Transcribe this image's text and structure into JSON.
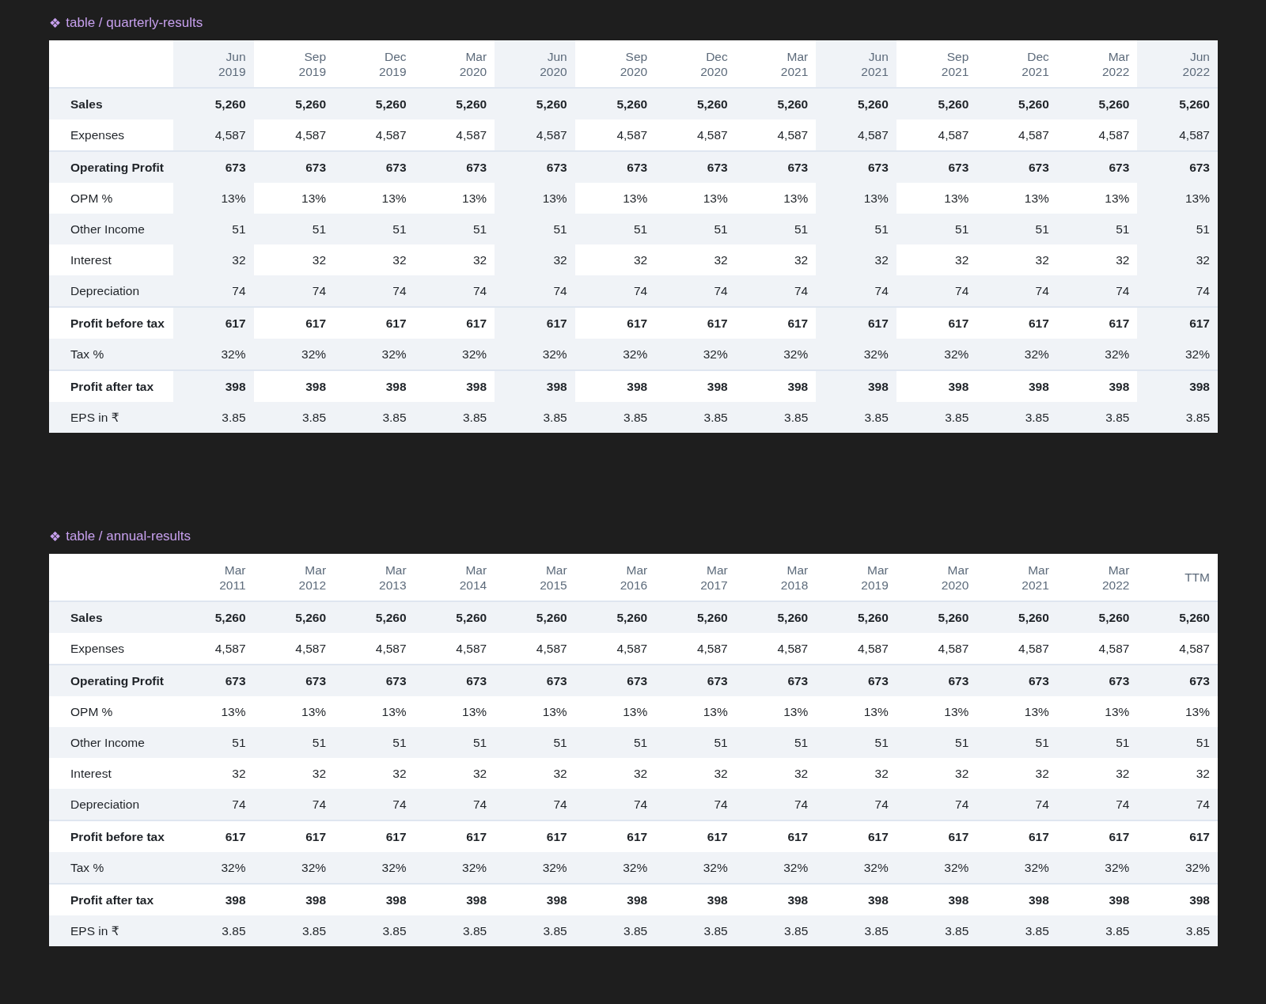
{
  "tables": [
    {
      "icon": "❖",
      "title": "table / quarterly-results",
      "columns": [
        {
          "lines": [
            "Jun",
            "2019"
          ],
          "highlighted": true
        },
        {
          "lines": [
            "Sep",
            "2019"
          ],
          "highlighted": false
        },
        {
          "lines": [
            "Dec",
            "2019"
          ],
          "highlighted": false
        },
        {
          "lines": [
            "Mar",
            "2020"
          ],
          "highlighted": false
        },
        {
          "lines": [
            "Jun",
            "2020"
          ],
          "highlighted": true
        },
        {
          "lines": [
            "Sep",
            "2020"
          ],
          "highlighted": false
        },
        {
          "lines": [
            "Dec",
            "2020"
          ],
          "highlighted": false
        },
        {
          "lines": [
            "Mar",
            "2021"
          ],
          "highlighted": false
        },
        {
          "lines": [
            "Jun",
            "2021"
          ],
          "highlighted": true
        },
        {
          "lines": [
            "Sep",
            "2021"
          ],
          "highlighted": false
        },
        {
          "lines": [
            "Dec",
            "2021"
          ],
          "highlighted": false
        },
        {
          "lines": [
            "Mar",
            "2022"
          ],
          "highlighted": false
        },
        {
          "lines": [
            "Jun",
            "2022"
          ],
          "highlighted": true
        }
      ],
      "rows": [
        {
          "label": "Sales",
          "bold": true,
          "divider": false,
          "values": [
            "5,260",
            "5,260",
            "5,260",
            "5,260",
            "5,260",
            "5,260",
            "5,260",
            "5,260",
            "5,260",
            "5,260",
            "5,260",
            "5,260",
            "5,260"
          ]
        },
        {
          "label": "Expenses",
          "bold": false,
          "divider": false,
          "values": [
            "4,587",
            "4,587",
            "4,587",
            "4,587",
            "4,587",
            "4,587",
            "4,587",
            "4,587",
            "4,587",
            "4,587",
            "4,587",
            "4,587",
            "4,587"
          ]
        },
        {
          "label": "Operating Profit",
          "bold": true,
          "divider": true,
          "values": [
            "673",
            "673",
            "673",
            "673",
            "673",
            "673",
            "673",
            "673",
            "673",
            "673",
            "673",
            "673",
            "673"
          ]
        },
        {
          "label": "OPM %",
          "bold": false,
          "divider": false,
          "values": [
            "13%",
            "13%",
            "13%",
            "13%",
            "13%",
            "13%",
            "13%",
            "13%",
            "13%",
            "13%",
            "13%",
            "13%",
            "13%"
          ]
        },
        {
          "label": "Other Income",
          "bold": false,
          "divider": false,
          "values": [
            "51",
            "51",
            "51",
            "51",
            "51",
            "51",
            "51",
            "51",
            "51",
            "51",
            "51",
            "51",
            "51"
          ]
        },
        {
          "label": "Interest",
          "bold": false,
          "divider": false,
          "values": [
            "32",
            "32",
            "32",
            "32",
            "32",
            "32",
            "32",
            "32",
            "32",
            "32",
            "32",
            "32",
            "32"
          ]
        },
        {
          "label": "Depreciation",
          "bold": false,
          "divider": false,
          "values": [
            "74",
            "74",
            "74",
            "74",
            "74",
            "74",
            "74",
            "74",
            "74",
            "74",
            "74",
            "74",
            "74"
          ]
        },
        {
          "label": "Profit before tax",
          "bold": true,
          "divider": true,
          "values": [
            "617",
            "617",
            "617",
            "617",
            "617",
            "617",
            "617",
            "617",
            "617",
            "617",
            "617",
            "617",
            "617"
          ]
        },
        {
          "label": "Tax %",
          "bold": false,
          "divider": false,
          "values": [
            "32%",
            "32%",
            "32%",
            "32%",
            "32%",
            "32%",
            "32%",
            "32%",
            "32%",
            "32%",
            "32%",
            "32%",
            "32%"
          ]
        },
        {
          "label": "Profit after tax",
          "bold": true,
          "divider": true,
          "values": [
            "398",
            "398",
            "398",
            "398",
            "398",
            "398",
            "398",
            "398",
            "398",
            "398",
            "398",
            "398",
            "398"
          ]
        },
        {
          "label": "EPS in ₹",
          "bold": false,
          "divider": false,
          "values": [
            "3.85",
            "3.85",
            "3.85",
            "3.85",
            "3.85",
            "3.85",
            "3.85",
            "3.85",
            "3.85",
            "3.85",
            "3.85",
            "3.85",
            "3.85"
          ]
        }
      ]
    },
    {
      "icon": "❖",
      "title": "table / annual-results",
      "columns": [
        {
          "lines": [
            "Mar",
            "2011"
          ],
          "highlighted": false
        },
        {
          "lines": [
            "Mar",
            "2012"
          ],
          "highlighted": false
        },
        {
          "lines": [
            "Mar",
            "2013"
          ],
          "highlighted": false
        },
        {
          "lines": [
            "Mar",
            "2014"
          ],
          "highlighted": false
        },
        {
          "lines": [
            "Mar",
            "2015"
          ],
          "highlighted": false
        },
        {
          "lines": [
            "Mar",
            "2016"
          ],
          "highlighted": false
        },
        {
          "lines": [
            "Mar",
            "2017"
          ],
          "highlighted": false
        },
        {
          "lines": [
            "Mar",
            "2018"
          ],
          "highlighted": false
        },
        {
          "lines": [
            "Mar",
            "2019"
          ],
          "highlighted": false
        },
        {
          "lines": [
            "Mar",
            "2020"
          ],
          "highlighted": false
        },
        {
          "lines": [
            "Mar",
            "2021"
          ],
          "highlighted": false
        },
        {
          "lines": [
            "Mar",
            "2022"
          ],
          "highlighted": false
        },
        {
          "lines": [
            "TTM"
          ],
          "highlighted": false
        }
      ],
      "rows": [
        {
          "label": "Sales",
          "bold": true,
          "divider": false,
          "values": [
            "5,260",
            "5,260",
            "5,260",
            "5,260",
            "5,260",
            "5,260",
            "5,260",
            "5,260",
            "5,260",
            "5,260",
            "5,260",
            "5,260",
            "5,260"
          ]
        },
        {
          "label": "Expenses",
          "bold": false,
          "divider": false,
          "values": [
            "4,587",
            "4,587",
            "4,587",
            "4,587",
            "4,587",
            "4,587",
            "4,587",
            "4,587",
            "4,587",
            "4,587",
            "4,587",
            "4,587",
            "4,587"
          ]
        },
        {
          "label": "Operating Profit",
          "bold": true,
          "divider": true,
          "values": [
            "673",
            "673",
            "673",
            "673",
            "673",
            "673",
            "673",
            "673",
            "673",
            "673",
            "673",
            "673",
            "673"
          ]
        },
        {
          "label": "OPM %",
          "bold": false,
          "divider": false,
          "values": [
            "13%",
            "13%",
            "13%",
            "13%",
            "13%",
            "13%",
            "13%",
            "13%",
            "13%",
            "13%",
            "13%",
            "13%",
            "13%"
          ]
        },
        {
          "label": "Other Income",
          "bold": false,
          "divider": false,
          "values": [
            "51",
            "51",
            "51",
            "51",
            "51",
            "51",
            "51",
            "51",
            "51",
            "51",
            "51",
            "51",
            "51"
          ]
        },
        {
          "label": "Interest",
          "bold": false,
          "divider": false,
          "values": [
            "32",
            "32",
            "32",
            "32",
            "32",
            "32",
            "32",
            "32",
            "32",
            "32",
            "32",
            "32",
            "32"
          ]
        },
        {
          "label": "Depreciation",
          "bold": false,
          "divider": false,
          "values": [
            "74",
            "74",
            "74",
            "74",
            "74",
            "74",
            "74",
            "74",
            "74",
            "74",
            "74",
            "74",
            "74"
          ]
        },
        {
          "label": "Profit before tax",
          "bold": true,
          "divider": true,
          "values": [
            "617",
            "617",
            "617",
            "617",
            "617",
            "617",
            "617",
            "617",
            "617",
            "617",
            "617",
            "617",
            "617"
          ]
        },
        {
          "label": "Tax %",
          "bold": false,
          "divider": false,
          "values": [
            "32%",
            "32%",
            "32%",
            "32%",
            "32%",
            "32%",
            "32%",
            "32%",
            "32%",
            "32%",
            "32%",
            "32%",
            "32%"
          ]
        },
        {
          "label": "Profit after tax",
          "bold": true,
          "divider": true,
          "values": [
            "398",
            "398",
            "398",
            "398",
            "398",
            "398",
            "398",
            "398",
            "398",
            "398",
            "398",
            "398",
            "398"
          ]
        },
        {
          "label": "EPS in ₹",
          "bold": false,
          "divider": false,
          "values": [
            "3.85",
            "3.85",
            "3.85",
            "3.85",
            "3.85",
            "3.85",
            "3.85",
            "3.85",
            "3.85",
            "3.85",
            "3.85",
            "3.85",
            "3.85"
          ]
        }
      ]
    }
  ]
}
